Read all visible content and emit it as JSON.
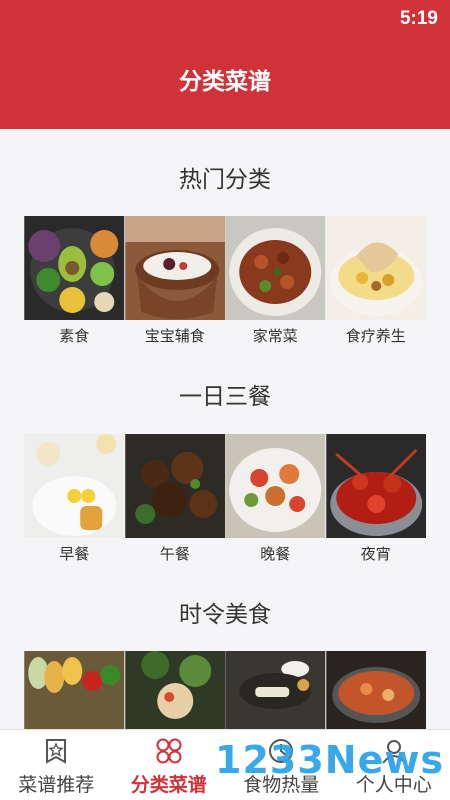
{
  "status": {
    "time": "5:19"
  },
  "header": {
    "title": "分类菜谱"
  },
  "sections": [
    {
      "title": "热门分类",
      "items": [
        "素食",
        "宝宝辅食",
        "家常菜",
        "食疗养生"
      ]
    },
    {
      "title": "一日三餐",
      "items": [
        "早餐",
        "午餐",
        "晚餐",
        "夜宵"
      ]
    },
    {
      "title": "时令美食",
      "items": [
        "",
        "",
        "",
        ""
      ]
    }
  ],
  "tabbar": {
    "tabs": [
      "菜谱推荐",
      "分类菜谱",
      "食物热量",
      "个人中心"
    ],
    "active_index": 1
  },
  "watermark": "1233News",
  "colors": {
    "brand": "#d0323a",
    "watermark": "#2fa4e8"
  }
}
